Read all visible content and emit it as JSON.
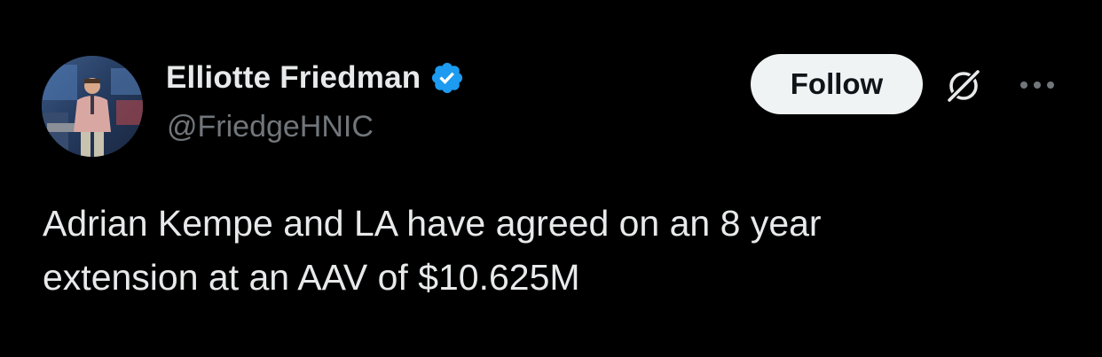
{
  "author": {
    "display_name": "Elliotte Friedman",
    "handle": "@FriedgeHNIC",
    "verified": true,
    "verified_color": "#1d9bf0"
  },
  "actions": {
    "follow_label": "Follow",
    "grok_icon": "grok-icon",
    "more_icon": "more-dots-icon"
  },
  "tweet": {
    "lines": [
      "Adrian Kempe and LA have agreed on an 8 year",
      "extension at an AAV of $10.625M"
    ]
  },
  "colors": {
    "background": "#000000",
    "primary_text": "#e7e9ea",
    "secondary_text": "#71767b",
    "button_bg": "#eff3f4",
    "button_text": "#0f1419"
  }
}
